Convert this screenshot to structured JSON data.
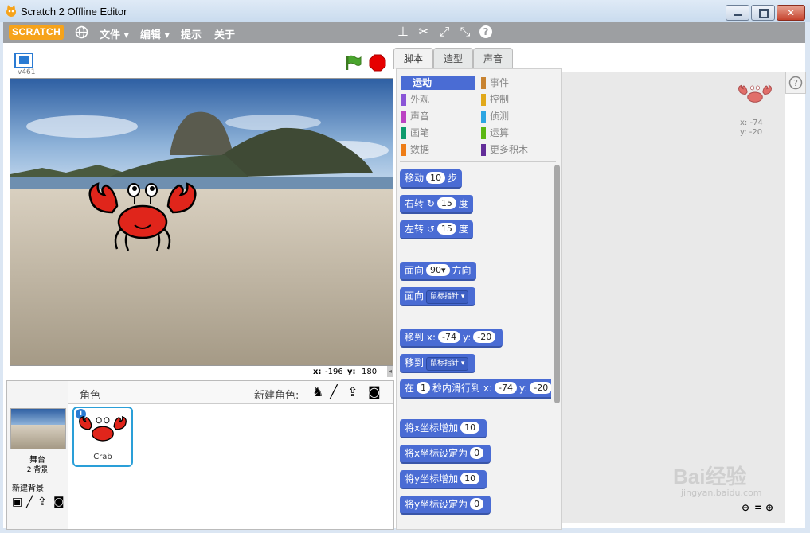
{
  "window": {
    "title": "Scratch 2 Offline Editor",
    "minimize_label": "▁",
    "maximize_label": "□",
    "close_label": "✕"
  },
  "menubar": {
    "logo": "SCRATCH",
    "items": [
      {
        "label": "文件 ▾"
      },
      {
        "label": "编辑 ▾"
      },
      {
        "label": "提示"
      },
      {
        "label": "关于"
      }
    ]
  },
  "stage": {
    "version": "v461",
    "mouse_x_label": "x:",
    "mouse_x": "-196",
    "mouse_y_label": "y:",
    "mouse_y": "180"
  },
  "sprites": {
    "header_label": "角色",
    "new_sprite_label": "新建角色:",
    "stage_label": "舞台",
    "stage_backdrops": "2 背景",
    "new_backdrop_label": "新建背景",
    "sprite_list": [
      {
        "name": "Crab"
      }
    ]
  },
  "tabs": [
    {
      "label": "脚本",
      "active": true
    },
    {
      "label": "造型",
      "active": false
    },
    {
      "label": "声音",
      "active": false
    }
  ],
  "categories": [
    {
      "label": "运动",
      "color": "#4a6cd4",
      "selected": true
    },
    {
      "label": "事件",
      "color": "#c88330"
    },
    {
      "label": "外观",
      "color": "#8a55d7"
    },
    {
      "label": "控制",
      "color": "#e1a91a"
    },
    {
      "label": "声音",
      "color": "#bb42c3"
    },
    {
      "label": "侦测",
      "color": "#2ca5e2"
    },
    {
      "label": "画笔",
      "color": "#0e9a6c"
    },
    {
      "label": "运算",
      "color": "#5cb712"
    },
    {
      "label": "数据",
      "color": "#ee7d16"
    },
    {
      "label": "更多积木",
      "color": "#632d99"
    }
  ],
  "blocks": {
    "move": {
      "a": "移动",
      "v": "10",
      "b": "步"
    },
    "turn_right": {
      "a": "右转",
      "icon": "↻",
      "v": "15",
      "b": "度"
    },
    "turn_left": {
      "a": "左转",
      "icon": "↺",
      "v": "15",
      "b": "度"
    },
    "point_dir": {
      "a": "面向",
      "v": "90▾",
      "b": "方向"
    },
    "point_towards": {
      "a": "面向",
      "d": "鼠标指针 ▾"
    },
    "goto_xy": {
      "a": "移到",
      "xl": "x:",
      "x": "-74",
      "yl": "y:",
      "y": "-20"
    },
    "goto": {
      "a": "移到",
      "d": "鼠标指针 ▾"
    },
    "glide": {
      "a": "在",
      "v": "1",
      "b": "秒内滑行到",
      "xl": "x:",
      "x": "-74",
      "yl": "y:",
      "y": "-20"
    },
    "change_x": {
      "a": "将x坐标增加",
      "v": "10"
    },
    "set_x": {
      "a": "将x坐标设定为",
      "v": "0"
    },
    "change_y": {
      "a": "将y坐标增加",
      "v": "10"
    },
    "set_y": {
      "a": "将y坐标设定为",
      "v": "0"
    }
  },
  "scripts_area": {
    "sprite_x": "x: -74",
    "sprite_y": "y: -20",
    "help_icon": "?"
  },
  "watermark": {
    "brand": "Bai经验",
    "url": "jingyan.baidu.com"
  }
}
